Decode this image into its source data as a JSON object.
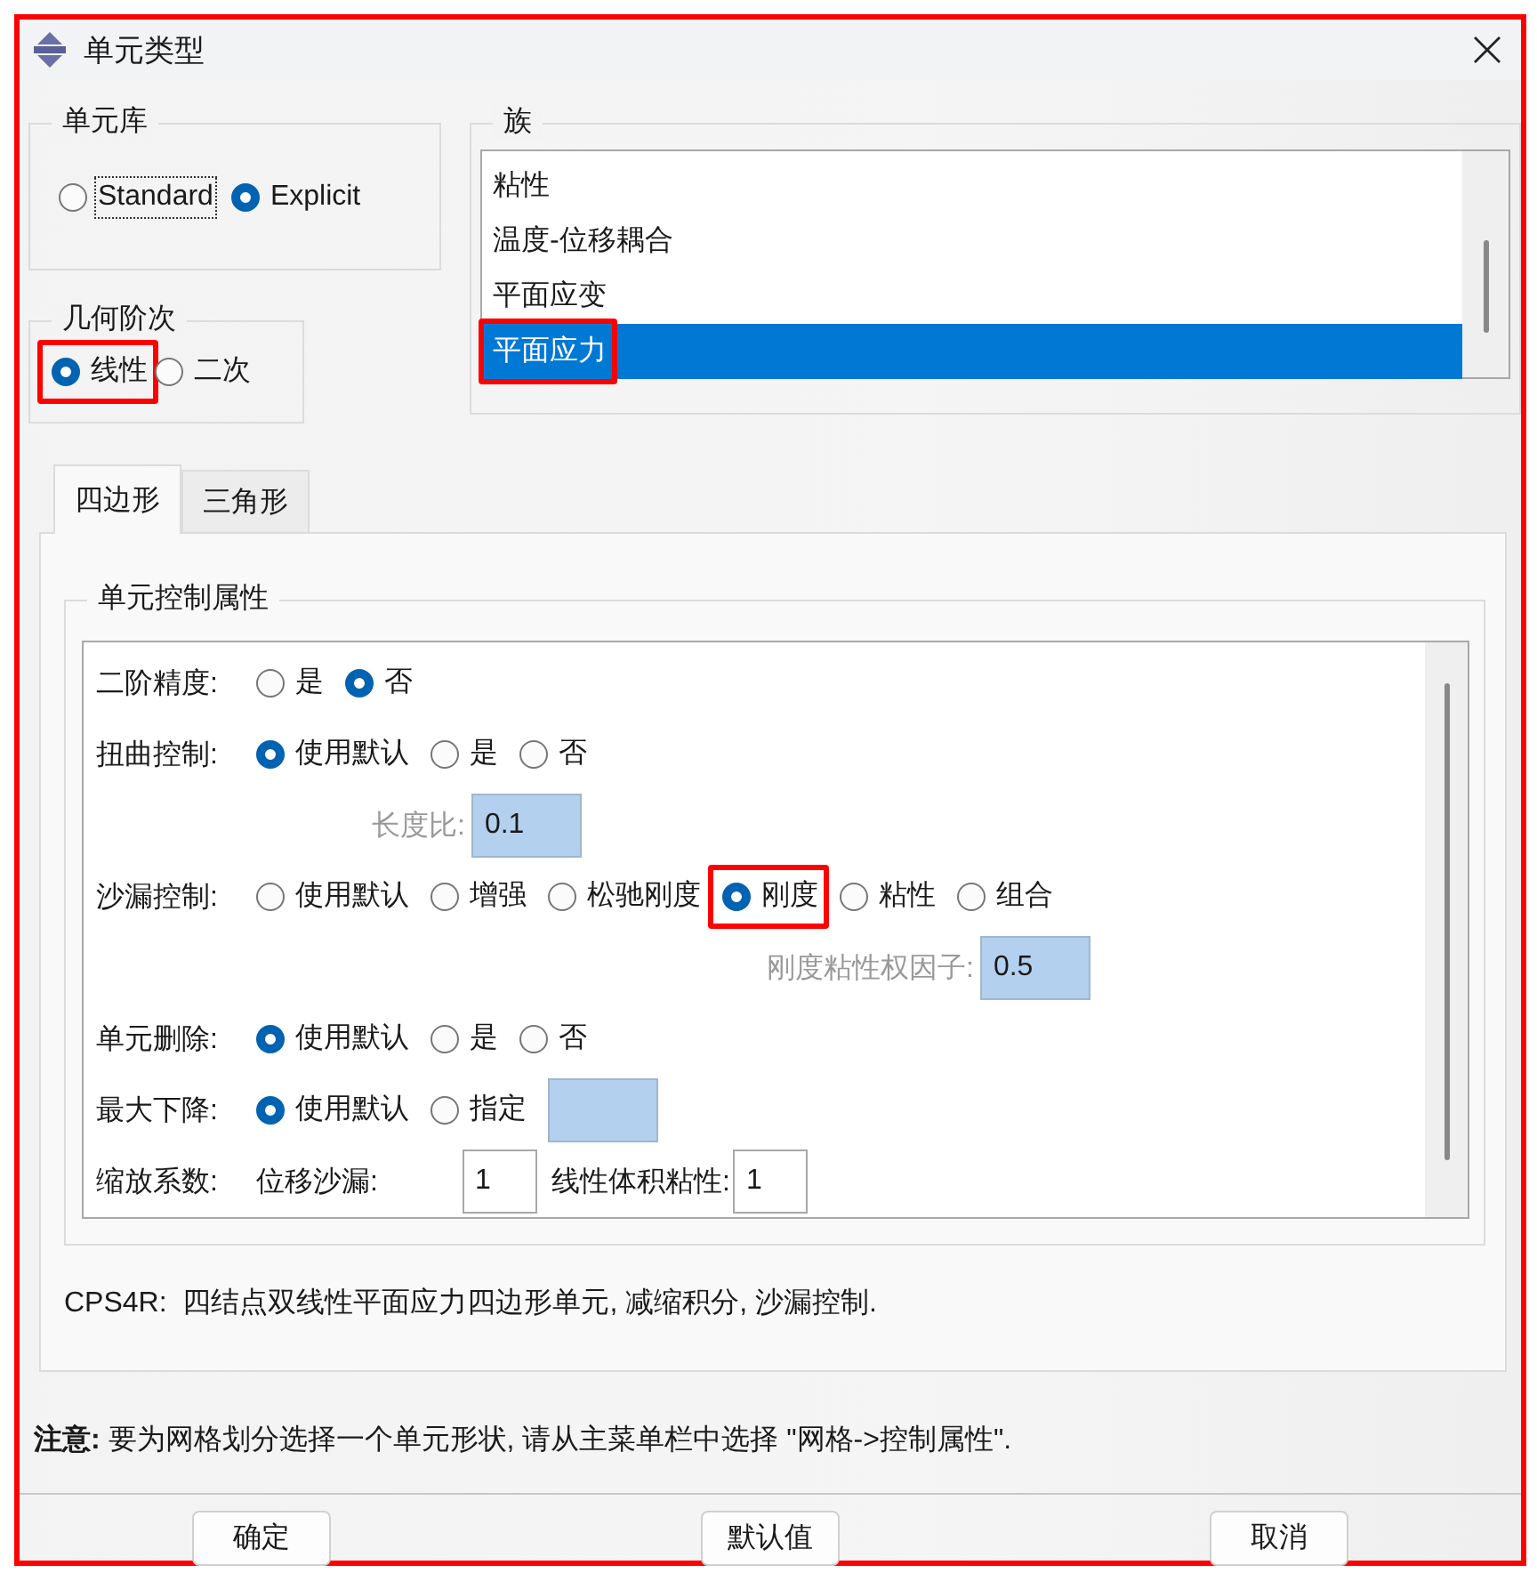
{
  "window": {
    "title": "单元类型",
    "highlighted": true
  },
  "library": {
    "title": "单元库",
    "options": [
      {
        "label": "Standard",
        "selected": false,
        "focused": true
      },
      {
        "label": "Explicit",
        "selected": true,
        "focused": false
      }
    ]
  },
  "order": {
    "title": "几何阶次",
    "options": [
      {
        "label": "线性",
        "selected": true,
        "highlighted": true
      },
      {
        "label": "二次",
        "selected": false,
        "highlighted": false
      }
    ]
  },
  "family": {
    "title": "族",
    "items": [
      {
        "label": "粘性",
        "selected": false,
        "highlighted": false
      },
      {
        "label": "温度-位移耦合",
        "selected": false,
        "highlighted": false
      },
      {
        "label": "平面应变",
        "selected": false,
        "highlighted": false
      },
      {
        "label": "平面应力",
        "selected": true,
        "highlighted": true
      }
    ]
  },
  "tabs": [
    {
      "label": "四边形",
      "selected": true
    },
    {
      "label": "三角形",
      "selected": false
    }
  ],
  "controls": {
    "title": "单元控制属性",
    "rows": [
      {
        "kind": "radio",
        "label": "二阶精度:",
        "options": [
          {
            "label": "是",
            "selected": false
          },
          {
            "label": "否",
            "selected": true
          }
        ]
      },
      {
        "kind": "radio",
        "label": "扭曲控制:",
        "options": [
          {
            "label": "使用默认",
            "selected": true
          },
          {
            "label": "是",
            "selected": false
          },
          {
            "label": "否",
            "selected": false
          }
        ]
      },
      {
        "kind": "field",
        "label": "长度比:",
        "value": "0.1",
        "disabled": true
      },
      {
        "kind": "radio",
        "label": "沙漏控制:",
        "options": [
          {
            "label": "使用默认",
            "selected": false,
            "highlighted": false
          },
          {
            "label": "增强",
            "selected": false,
            "highlighted": false
          },
          {
            "label": "松驰刚度",
            "selected": false,
            "highlighted": false
          },
          {
            "label": "刚度",
            "selected": true,
            "highlighted": true
          },
          {
            "label": "粘性",
            "selected": false,
            "highlighted": false
          },
          {
            "label": "组合",
            "selected": false,
            "highlighted": false
          }
        ]
      },
      {
        "kind": "field",
        "label": "刚度粘性权因子:",
        "value": "0.5",
        "disabled": true
      },
      {
        "kind": "radio",
        "label": "单元删除:",
        "options": [
          {
            "label": "使用默认",
            "selected": true
          },
          {
            "label": "是",
            "selected": false
          },
          {
            "label": "否",
            "selected": false
          }
        ]
      },
      {
        "kind": "radio",
        "label": "最大下降:",
        "options": [
          {
            "label": "使用默认",
            "selected": true
          },
          {
            "label": "指定",
            "selected": false
          }
        ],
        "field": {
          "disabled": true
        }
      },
      {
        "kind": "scale",
        "label": "缩放系数:",
        "fields": [
          {
            "label": "位移沙漏:",
            "value": "1",
            "disabled": false
          },
          {
            "label": "线性体积粘性:",
            "value": "1",
            "disabled": false
          }
        ]
      }
    ]
  },
  "description": "CPS4R:  四结点双线性平面应力四边形单元, 减缩积分, 沙漏控制.",
  "note": "**注意:** 要为网格划分选择一个单元形状, 请从主菜单栏中选择 \"网格->控制属性\".",
  "buttons": [
    "确定",
    "默认值",
    "取消"
  ]
}
